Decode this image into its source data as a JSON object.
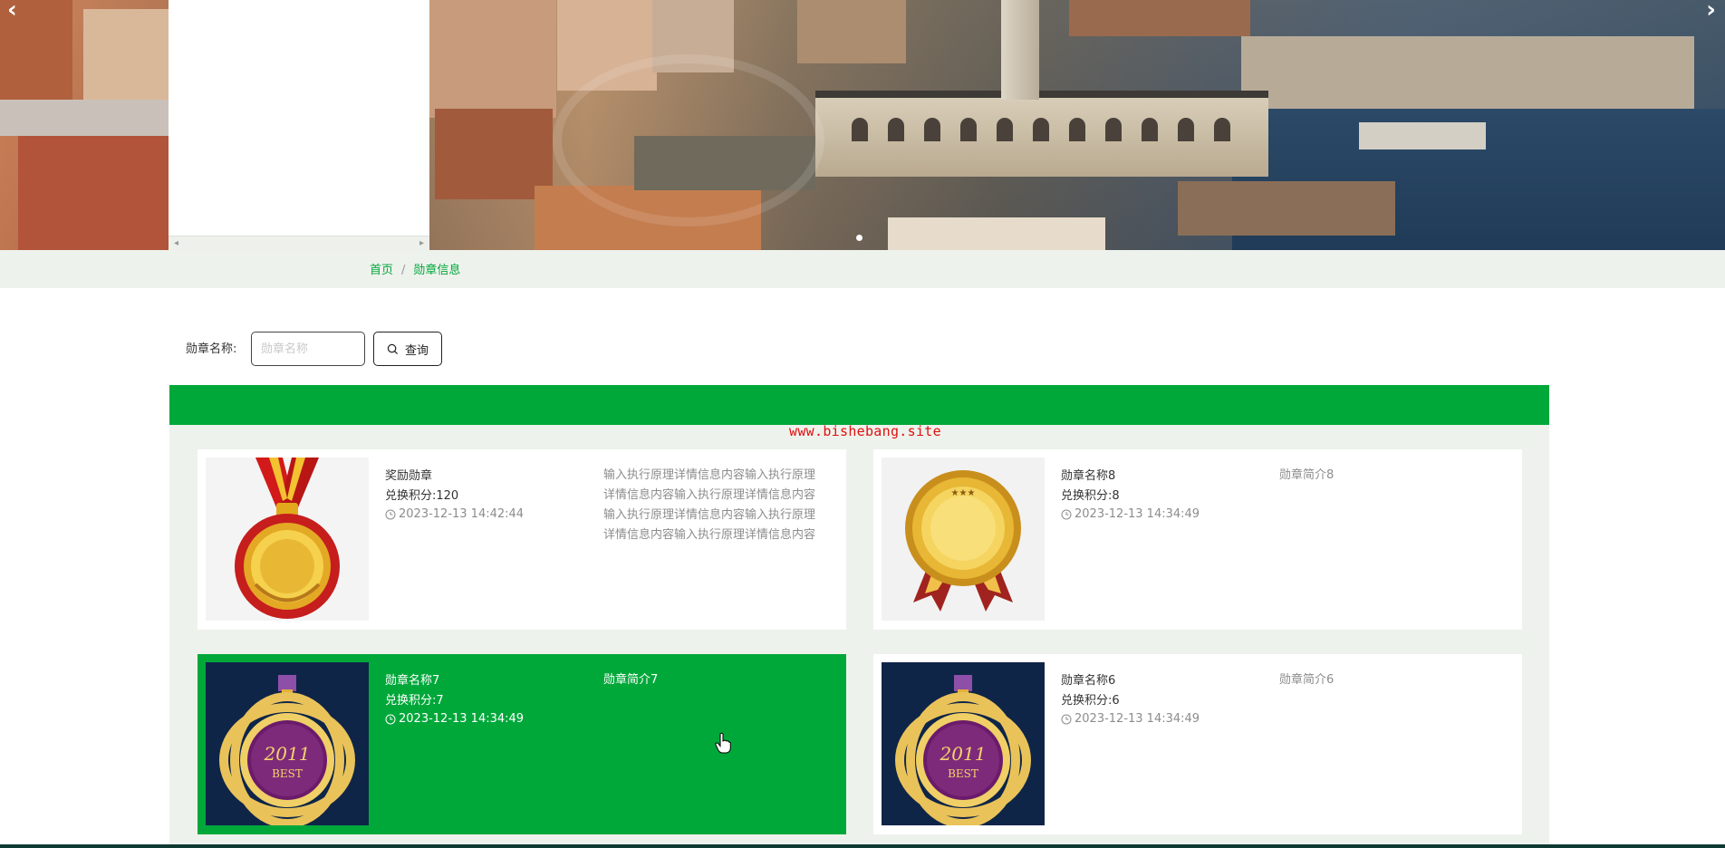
{
  "banner": {
    "prev_arrow": "‹",
    "next_arrow": "›",
    "scroll_left": "◂",
    "scroll_right": "▸"
  },
  "breadcrumb": {
    "home": "首页",
    "separator": "/",
    "current": "勋章信息"
  },
  "search": {
    "label": "勋章名称:",
    "placeholder": "勋章名称",
    "value": "",
    "button_label": "查询"
  },
  "watermark": "www.bishebang.site",
  "colors": {
    "accent": "#00a83a",
    "list_bg": "#eef2ec",
    "watermark": "#e01010"
  },
  "medals": [
    {
      "name": "奖励勋章",
      "points": "兑换积分:120",
      "time": "2023-12-13 14:42:44",
      "desc": "输入执行原理详情信息内容输入执行原理详情信息内容输入执行原理详情信息内容输入执行原理详情信息内容输入执行原理详情信息内容输入执行原理详情信息内容",
      "image": "red-ribbon-gold-medal",
      "active": false
    },
    {
      "name": "勋章名称8",
      "points": "兑换积分:8",
      "time": "2023-12-13 14:34:49",
      "desc": "勋章简介8",
      "image": "gold-rosette-medal",
      "active": false
    },
    {
      "name": "勋章名称7",
      "points": "兑换积分:7",
      "time": "2023-12-13 14:34:49",
      "desc": "勋章简介7",
      "image": "purple-best-2011-medal",
      "active": true
    },
    {
      "name": "勋章名称6",
      "points": "兑换积分:6",
      "time": "2023-12-13 14:34:49",
      "desc": "勋章简介6",
      "image": "purple-best-2011-medal",
      "active": false
    }
  ],
  "medal_badge": {
    "year": "2011",
    "word": "BEST"
  }
}
